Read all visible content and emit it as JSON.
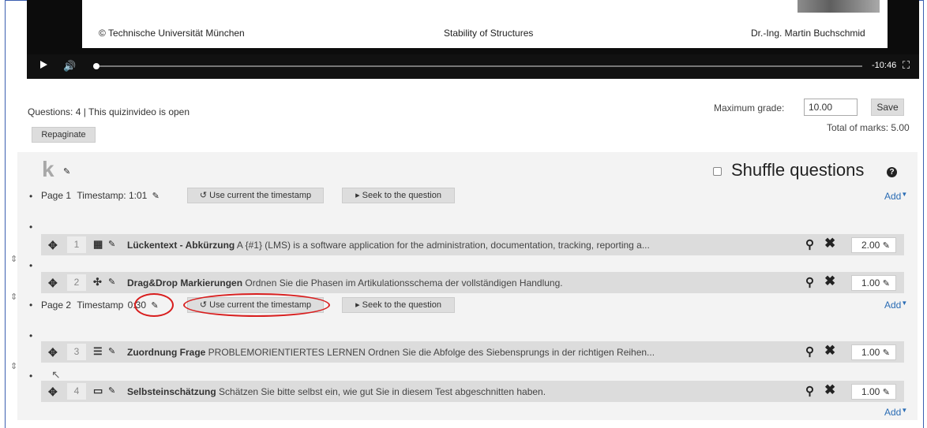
{
  "video": {
    "slide_copyright": "© Technische Universität München",
    "slide_course": "Stability of Structures",
    "slide_author": "Dr.-Ing. Martin Buchschmid",
    "time_remaining": "-10:46"
  },
  "quiz": {
    "info": "Questions: 4 | This quizinvideo is open",
    "repaginate_label": "Repaginate",
    "max_grade_label": "Maximum grade:",
    "max_grade_value": "10.00",
    "save_label": "Save",
    "total_marks": "Total of marks: 5.00"
  },
  "section": {
    "heading": "k",
    "shuffle_label": "Shuffle questions",
    "add_label": "Add"
  },
  "pages": [
    {
      "label": "Page 1",
      "timestamp_label": "Timestamp: 1:01",
      "use_current_label": "Use current the timestamp",
      "seek_label": "Seek to the question"
    },
    {
      "label": "Page 2",
      "timestamp_label": "Timestamp",
      "timestamp_value": "0:30",
      "use_current_label": "Use current the timestamp",
      "seek_label": "Seek to the question"
    }
  ],
  "questions": [
    {
      "number": "1",
      "type_icon": "cloze-icon",
      "name": "Lückentext - Abkürzung",
      "text": "A {#1} (LMS) is a software application for the administration, documentation, tracking, reporting a...",
      "mark": "2.00"
    },
    {
      "number": "2",
      "type_icon": "drag-drop-markers-icon",
      "name": "Drag&Drop Markierungen",
      "text": "Ordnen Sie die Phasen im Artikulationsschema der vollständigen Handlung.",
      "mark": "1.00"
    },
    {
      "number": "3",
      "type_icon": "matching-icon",
      "name": "Zuordnung Frage",
      "text": "PROBLEMORIENTIERTES LERNEN Ordnen Sie die Abfolge des Siebensprungs in der richtigen Reihen...",
      "mark": "1.00"
    },
    {
      "number": "4",
      "type_icon": "short-answer-icon",
      "name": "Selbsteinschätzung",
      "text": "Schätzen Sie bitte selbst ein, wie gut Sie in diesem Test abgeschnitten haben.",
      "mark": "1.00"
    }
  ],
  "annotations": {
    "color": "#d81e1e"
  }
}
